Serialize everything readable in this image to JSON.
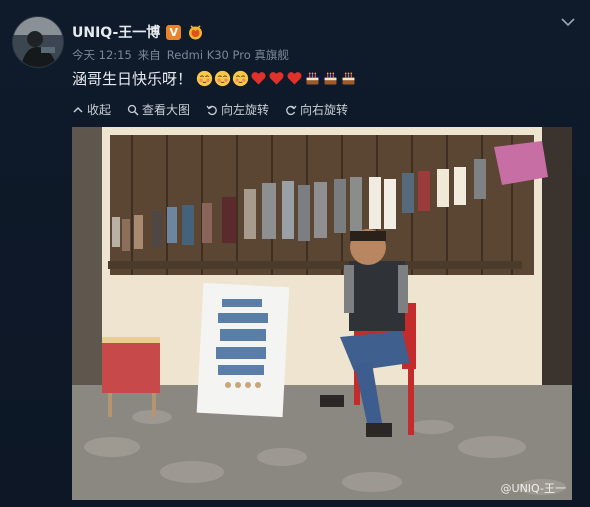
{
  "post": {
    "username": "UNIQ-王一博",
    "vip_badge": "V",
    "timestamp": "今天 12:15",
    "source_prefix": "来自",
    "source_device": "Redmi K30 Pro 真旗舰",
    "text": "涵哥生日快乐呀！",
    "emojis": [
      "blush-face",
      "blush-face",
      "blush-face",
      "red-heart",
      "red-heart",
      "red-heart",
      "birthday-cake",
      "birthday-cake",
      "birthday-cake"
    ]
  },
  "toolbar": {
    "collapse": "收起",
    "view_large": "查看大图",
    "rotate_left": "向左旋转",
    "rotate_right": "向右旋转"
  },
  "photo": {
    "watermark": "@UNIQ-王一"
  },
  "colors": {
    "background": "#0f1a2a",
    "username": "#e7ebf0",
    "meta": "#7b8796",
    "badge": "#e8852a",
    "heart": "#e0312b"
  }
}
